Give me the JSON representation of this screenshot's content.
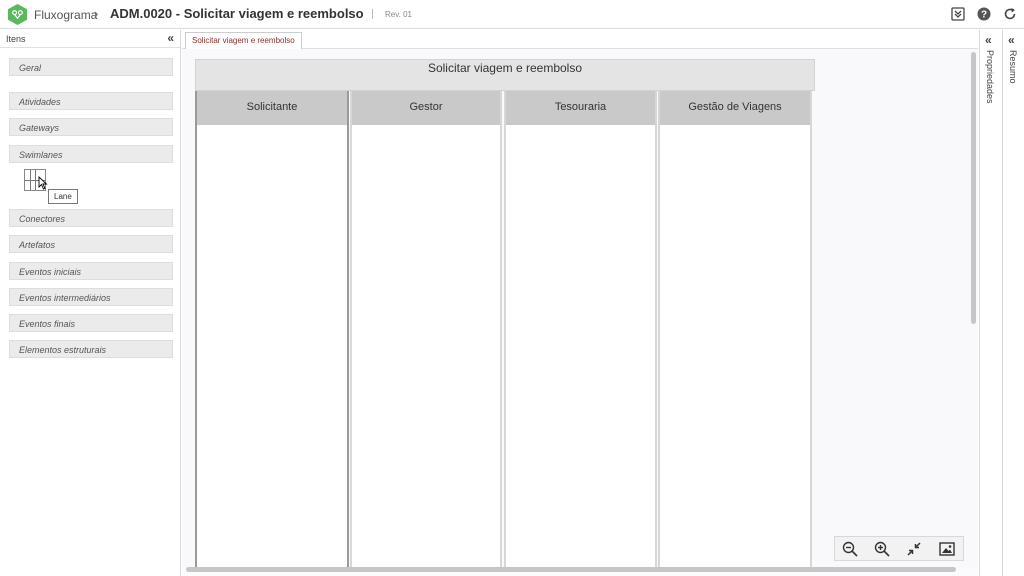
{
  "header": {
    "app_name": "Fluxograma",
    "separator": "›",
    "title": "ADM.0020 - Solicitar viagem e reembolso",
    "revision": "Rev. 01",
    "icons": [
      "logo-icon",
      "download-icon",
      "help-icon",
      "refresh-icon"
    ]
  },
  "left_panel": {
    "title": "Itens",
    "collapse": "«",
    "categories": [
      "Geral",
      "Atividades",
      "Gateways",
      "Swimlanes",
      "Conectores",
      "Artefatos",
      "Eventos iniciais",
      "Eventos intermediários",
      "Eventos finais",
      "Elementos estruturais"
    ],
    "tooltip": "Lane"
  },
  "canvas": {
    "tab_label": "Solicitar viagem e reembolso",
    "pool_title": "Solicitar viagem e reembolso",
    "lanes": [
      "Solicitante",
      "Gestor",
      "Tesouraria",
      "Gestão de Viagens"
    ]
  },
  "zoom_controls": [
    "zoom-out-icon",
    "zoom-in-icon",
    "fit-screen-icon",
    "export-image-icon"
  ],
  "right_rails": {
    "properties_label": "Propriedades",
    "summary_label": "Resumo",
    "collapse": "«"
  },
  "colors": {
    "brand": "#5cb85c",
    "tab_text": "#8b2c2c",
    "lane_header": "#c9c9c9",
    "pool_header": "#e4e4e4"
  }
}
